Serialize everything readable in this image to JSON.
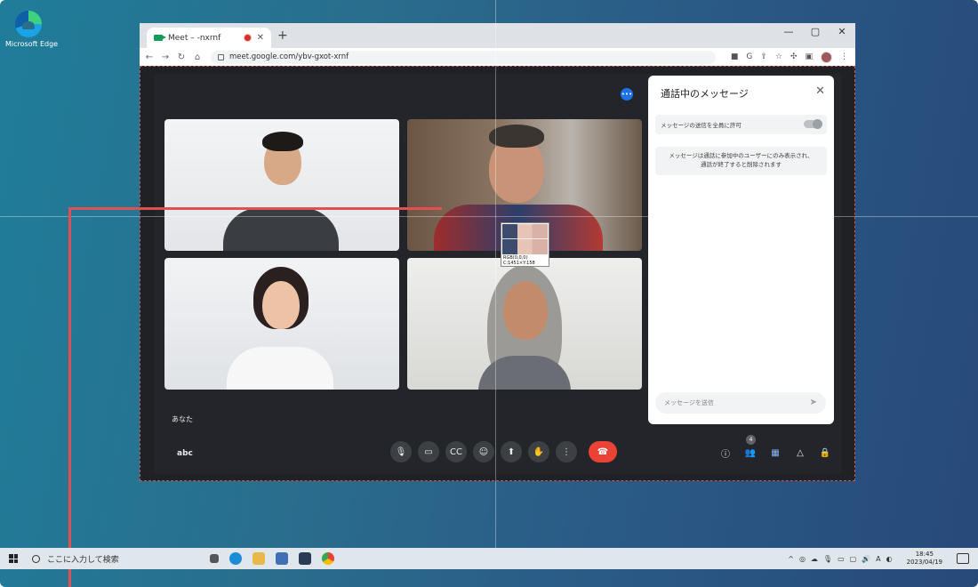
{
  "desktop": {
    "edge_label": "Microsoft Edge"
  },
  "browser": {
    "tab_title": "Meet – -nxrnf",
    "new_tab": "+",
    "window_controls": [
      "—",
      "▢",
      "✕"
    ],
    "url": "meet.google.com/ybv-gxot-xrnf",
    "nav": {
      "back": "←",
      "forward": "→",
      "reload": "↻",
      "home": "⌂"
    }
  },
  "meet": {
    "you_label": "あなた",
    "meeting_code": "abc",
    "participants_count": "4",
    "controls": [
      "mic",
      "camera",
      "captions",
      "emoji",
      "present",
      "raise-hand",
      "more",
      "leave-call"
    ]
  },
  "chat": {
    "title": "通話中のメッセージ",
    "allow_messages_label": "メッセージの送信を全員に許可",
    "info_line1": "メッセージは通話に参加中のユーザーにのみ表示され、",
    "info_line2": "通話が終了すると削除されます",
    "input_placeholder": "メッセージを送信"
  },
  "zoom_overlay": {
    "label1": "RGB(0,0,0)",
    "label2": "C:1451×Y:158"
  },
  "taskbar": {
    "search_placeholder": "ここに入力して検索",
    "time": "18:45",
    "date": "2023/04/19",
    "ime": "A"
  },
  "colors": {
    "end_call": "#ea4335",
    "callout": "#e05050",
    "meet_bg": "#202124",
    "accent": "#1a73e8"
  }
}
